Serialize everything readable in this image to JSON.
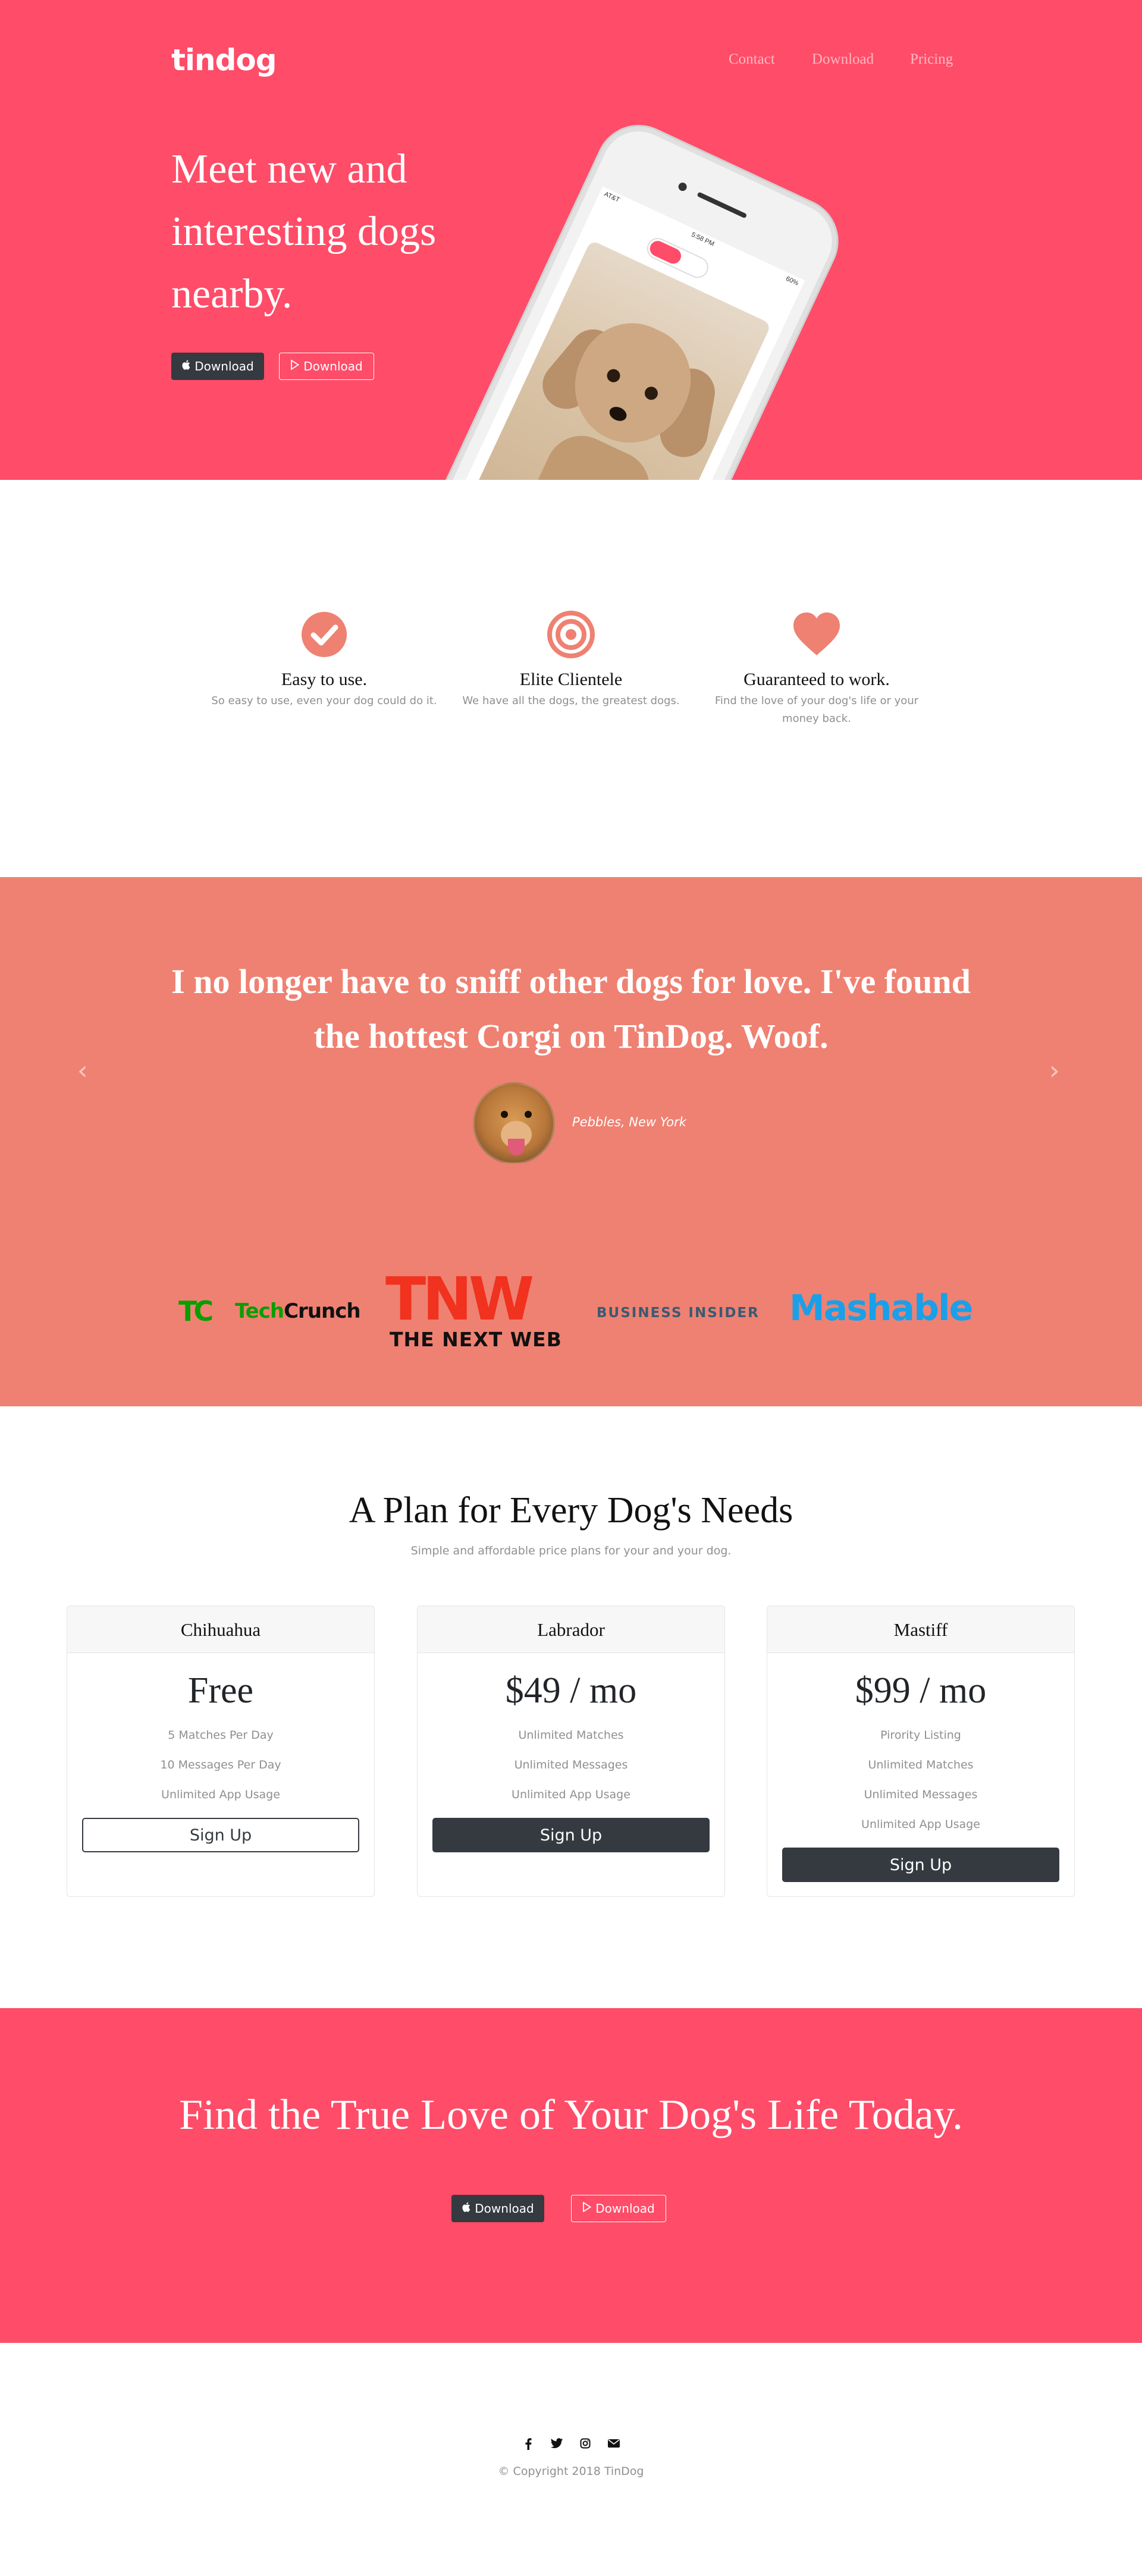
{
  "navbar": {
    "brand": "tindog",
    "links": [
      {
        "label": "Contact"
      },
      {
        "label": "Download"
      },
      {
        "label": "Pricing"
      }
    ]
  },
  "hero": {
    "heading": "Meet new and interesting dogs nearby.",
    "buttons": [
      {
        "label": "Download",
        "icon": "apple-icon",
        "style": "dark"
      },
      {
        "label": "Download",
        "icon": "play-icon",
        "style": "outline"
      }
    ],
    "phone": {
      "carrier": "AT&T",
      "time": "5:58 PM",
      "battery": "60%"
    }
  },
  "features": [
    {
      "icon": "check-circle-icon",
      "title": "Easy to use.",
      "text": "So easy to use, even your dog could do it."
    },
    {
      "icon": "bullseye-icon",
      "title": "Elite Clientele",
      "text": "We have all the dogs, the greatest dogs."
    },
    {
      "icon": "heart-icon",
      "title": "Guaranteed to work.",
      "text": "Find the love of your dog's life or your money back."
    }
  ],
  "testimonial": {
    "quote": "I no longer have to sniff other dogs for love. I've found the hottest Corgi on TinDog. Woof.",
    "author": "Pebbles, New York",
    "prev_icon": "chevron-left-icon",
    "next_icon": "chevron-right-icon"
  },
  "press": {
    "techcrunch": {
      "mark": "TC",
      "part1": "Tech",
      "part2": "Crunch"
    },
    "tnw": {
      "mark": "TNW",
      "text": "THE NEXT WEB"
    },
    "business_insider": "BUSINESS INSIDER",
    "mashable": "Mashable"
  },
  "pricing": {
    "heading": "A Plan for Every Dog's Needs",
    "subheading": "Simple and affordable price plans for your and your dog.",
    "plans": [
      {
        "name": "Chihuahua",
        "price": "Free",
        "features": [
          "5 Matches Per Day",
          "10 Messages Per Day",
          "Unlimited App Usage"
        ],
        "button": "Sign Up"
      },
      {
        "name": "Labrador",
        "price": "$49 / mo",
        "features": [
          "Unlimited Matches",
          "Unlimited Messages",
          "Unlimited App Usage"
        ],
        "button": "Sign Up"
      },
      {
        "name": "Mastiff",
        "price": "$99 / mo",
        "features": [
          "Pirority Listing",
          "Unlimited Matches",
          "Unlimited Messages",
          "Unlimited App Usage"
        ],
        "button": "Sign Up"
      }
    ]
  },
  "cta": {
    "heading": "Find the True Love of Your Dog's Life Today.",
    "buttons": [
      {
        "label": "Download",
        "icon": "apple-icon"
      },
      {
        "label": "Download",
        "icon": "play-icon"
      }
    ]
  },
  "footer": {
    "social_icons": [
      "facebook-icon",
      "twitter-icon",
      "instagram-icon",
      "envelope-icon"
    ],
    "copyright": "© Copyright 2018 TinDog"
  },
  "colors": {
    "brand_red": "#ff4c68",
    "coral": "#ef8172",
    "dark": "#343a40"
  }
}
